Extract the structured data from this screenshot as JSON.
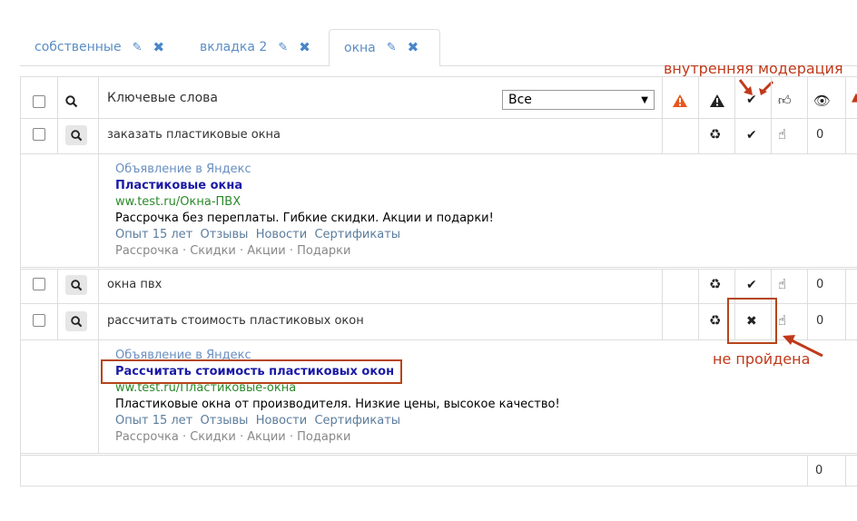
{
  "tabs": [
    {
      "label": "собственные",
      "active": false
    },
    {
      "label": "вкладка 2",
      "active": false
    },
    {
      "label": "окна",
      "active": true
    }
  ],
  "header": {
    "keywords_label": "Ключевые слова",
    "filter_value": "Все"
  },
  "rows": [
    {
      "keyword": "заказать пластиковые окна",
      "count": "0",
      "moderation": "check"
    },
    {
      "keyword": "окна пвх",
      "count": "0",
      "moderation": "check"
    },
    {
      "keyword": "рассчитать стоимость пластиковых окон",
      "count": "0",
      "moderation": "cross"
    }
  ],
  "ads": [
    {
      "source": "Объявление в Яндекс",
      "title": "Пластиковые окна",
      "url": "ww.test.ru/Окна-ПВХ",
      "text": "Рассрочка без переплаты. Гибкие скидки. Акции и подарки!",
      "links": "Опыт 15 лет  Отзывы  Новости  Сертификаты",
      "tags": "Рассрочка · Скидки · Акции · Подарки"
    },
    {
      "source": "Объявление в Яндекс",
      "title": "Рассчитать стоимость пластиковых окон",
      "url": "ww.test.ru/Пластиковые-окна",
      "text": "Пластиковые окна от производителя. Низкие цены, высокое качество!",
      "links": "Опыт 15 лет  Отзывы  Новости  Сертификаты",
      "tags": "Рассрочка · Скидки · Акции · Подарки"
    }
  ],
  "footer": {
    "total": "0"
  },
  "annotations": {
    "internal_moderation": "внутренняя модерация",
    "not_passed": "не пройдена"
  },
  "colors": {
    "accent": "#4a86c8",
    "annotation": "#c0391a",
    "warning": "#e8561c"
  }
}
